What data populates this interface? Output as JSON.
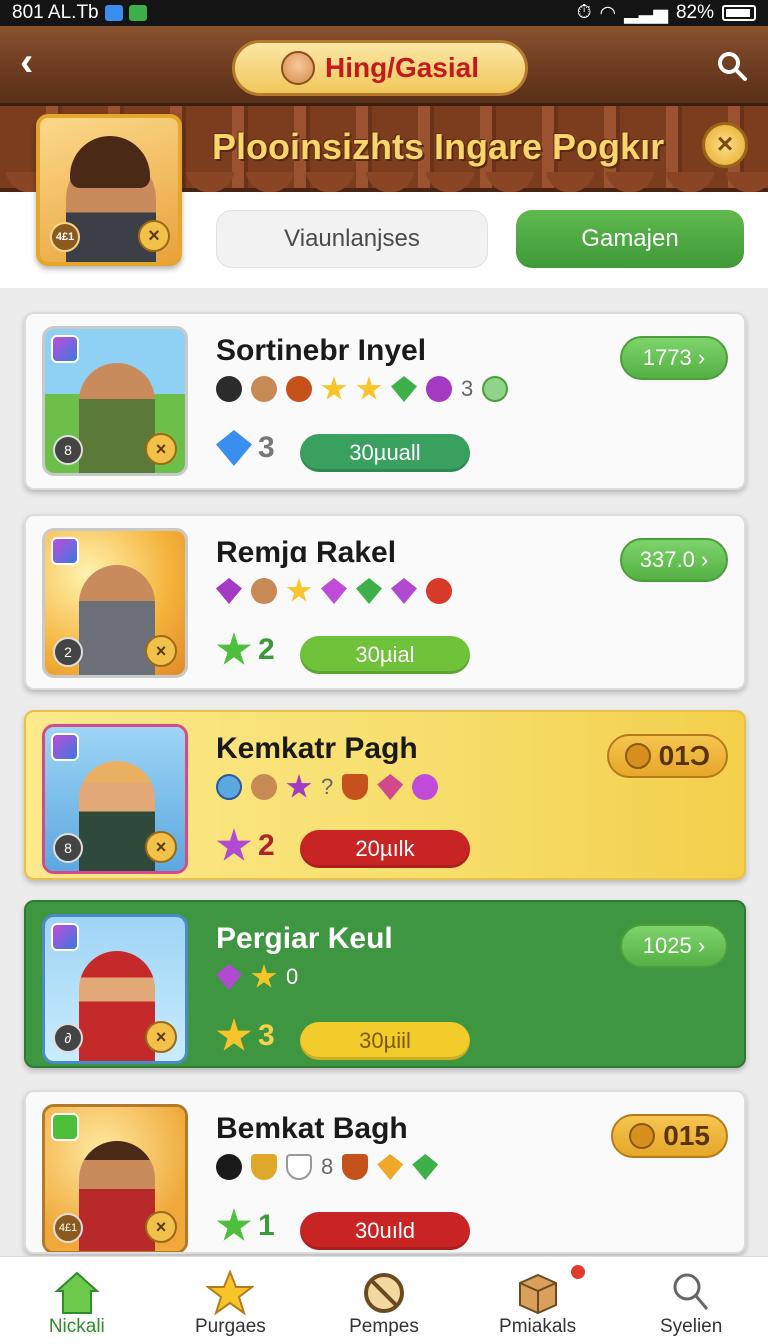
{
  "status": {
    "left_text": "801 AL.Tb",
    "battery": "82%"
  },
  "header": {
    "title": "Hing/Gasial"
  },
  "banner": {
    "title": "Plooinsizhts Ingare Pogkır",
    "close_symbol": "×"
  },
  "profile": {
    "badge_left": "4£1",
    "badge_x": "×"
  },
  "buttons": {
    "secondary": "Viaunlanjses",
    "primary": "Gamajen"
  },
  "cards": [
    {
      "title": "Sortinebr Inyel",
      "score": "1773 ›",
      "stat": "3",
      "pill": "30µuall",
      "icons_text": "3",
      "badge": "8",
      "variant": "white",
      "pill_color": "#3aa060"
    },
    {
      "title": "Remjɑ Rakel",
      "score": "337.0 ›",
      "stat": "2",
      "pill": "30µial",
      "badge": "2",
      "variant": "white",
      "pill_color": "#6fc23a"
    },
    {
      "title": "Kemkatr Pagh",
      "score": "01Ɔ",
      "stat": "2",
      "pill": "20µılk",
      "icons_text": "?",
      "badge": "8",
      "variant": "gold",
      "pill_color": "#c92424"
    },
    {
      "title": "Pergiar Keul",
      "score": "1025 ›",
      "stat": "3",
      "pill": "30µiil",
      "icons_text": "0",
      "badge": "∂",
      "variant": "green",
      "pill_color": "#f1cc2a"
    },
    {
      "title": "Bemkat Bagh",
      "score": "015",
      "stat": "1",
      "pill": "30uıld",
      "icons_text": "8",
      "badge": "4£1",
      "variant": "white",
      "pill_color": "#c92424"
    }
  ],
  "nav": [
    {
      "label": "Nickali",
      "icon": "home-icon"
    },
    {
      "label": "Purgaes",
      "icon": "star-icon"
    },
    {
      "label": "Pempes",
      "icon": "no-entry-icon"
    },
    {
      "label": "Pmiakals",
      "icon": "box-icon"
    },
    {
      "label": "Syelien",
      "icon": "search-person-icon"
    }
  ],
  "colors": {
    "accent_green": "#3f9a38",
    "wood": "#6b3a1f",
    "gold": "#f0c75c",
    "title_red": "#c4191d"
  }
}
